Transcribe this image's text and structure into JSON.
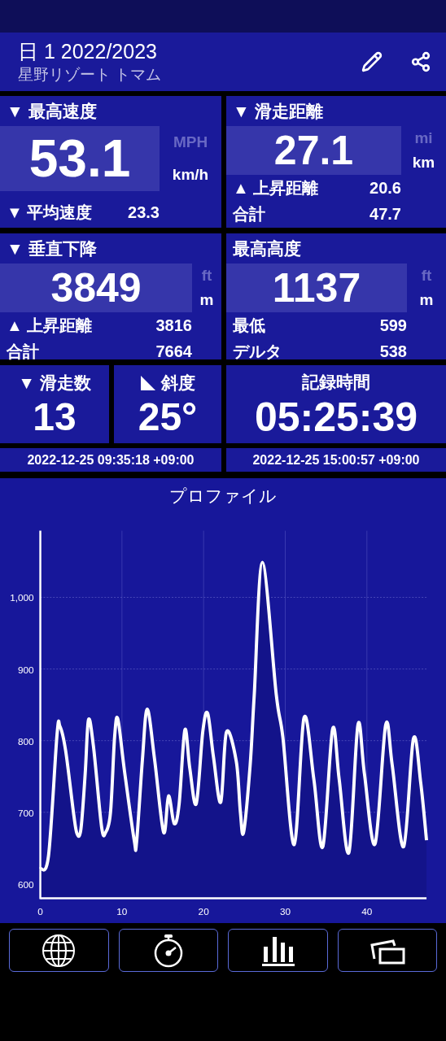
{
  "header": {
    "title": "日 1 2022/2023",
    "subtitle": "星野リゾート トマム"
  },
  "cards": [
    {
      "kind": "large",
      "title": "▼ 最高速度",
      "value": "53.1",
      "units": [
        {
          "label": "MPH",
          "selected": false
        },
        {
          "label": "km/h",
          "selected": true
        }
      ],
      "rows": [
        {
          "label": "▼ 平均速度",
          "value": "23.3"
        }
      ]
    },
    {
      "kind": "metric",
      "title": "▼ 滑走距離",
      "value": "27.1",
      "units": [
        {
          "label": "mi",
          "selected": false
        },
        {
          "label": "km",
          "selected": true
        }
      ],
      "rows": [
        {
          "label": "▲ 上昇距離",
          "value": "20.6"
        },
        {
          "label": "合計",
          "value": "47.7"
        }
      ]
    },
    {
      "kind": "metric",
      "title": "▼ 垂直下降",
      "value": "3849",
      "units": [
        {
          "label": "ft",
          "selected": false
        },
        {
          "label": "m",
          "selected": true
        }
      ],
      "rows": [
        {
          "label": "▲ 上昇距離",
          "value": "3816"
        },
        {
          "label": "合計",
          "value": "7664"
        }
      ]
    },
    {
      "kind": "metric",
      "title": "最高高度",
      "value": "1137",
      "units": [
        {
          "label": "ft",
          "selected": false
        },
        {
          "label": "m",
          "selected": true
        }
      ],
      "rows": [
        {
          "label": "最低",
          "value": "599"
        },
        {
          "label": "デルタ",
          "value": "538"
        }
      ]
    }
  ],
  "tiles": [
    {
      "kind": "count",
      "title": "▼ 滑走数",
      "value": "13"
    },
    {
      "kind": "slope",
      "title": "斜度",
      "value": "25°"
    },
    {
      "kind": "duration",
      "title": "記録時間",
      "value": "05:25:39"
    }
  ],
  "timestamps": [
    "2022-12-25 09:35:18 +09:00",
    "2022-12-25 15:00:57 +09:00"
  ],
  "profile": {
    "title": "プロファイル",
    "chart_data": {
      "type": "area",
      "grid": true,
      "xlim": [
        0,
        47.3
      ],
      "ylim": [
        580,
        1093
      ],
      "xticks": [
        0,
        10,
        20,
        30,
        40
      ],
      "yticks": [
        600,
        700,
        800,
        900,
        {
          "value": 1000,
          "label": "1,000"
        }
      ],
      "x": [
        0,
        1.0,
        2.05,
        2.4,
        3.1,
        4.1,
        4.5,
        4.97,
        5.5,
        5.9,
        6.5,
        7.5,
        8.0,
        8.6,
        9.1,
        9.5,
        10.3,
        11.5,
        11.8,
        12.5,
        13.1,
        14.0,
        15.1,
        15.7,
        16.4,
        17.0,
        17.7,
        18.3,
        19.1,
        19.9,
        20.5,
        21.2,
        22.1,
        22.8,
        24.0,
        24.5,
        24.9,
        25.7,
        26.2,
        27.2,
        28.9,
        29.7,
        31.1,
        32.3,
        33.5,
        34.6,
        35.8,
        36.6,
        37.8,
        38.9,
        39.7,
        41.0,
        42.3,
        43.1,
        44.5,
        45.7,
        46.6,
        47.3
      ],
      "series": [
        {
          "color": "#ffffff",
          "values": [
            621,
            639,
            809,
            820,
            786,
            696,
            670,
            676,
            754,
            829,
            793,
            680,
            672,
            700,
            805,
            830,
            758,
            661,
            659,
            773,
            844,
            773,
            672,
            723,
            684,
            711,
            815,
            762,
            712,
            813,
            838,
            778,
            714,
            812,
            771,
            700,
            672,
            766,
            864,
            1049,
            864,
            805,
            655,
            832,
            746,
            652,
            816,
            746,
            644,
            822,
            753,
            656,
            822,
            766,
            652,
            803,
            740,
            661
          ]
        }
      ]
    }
  }
}
